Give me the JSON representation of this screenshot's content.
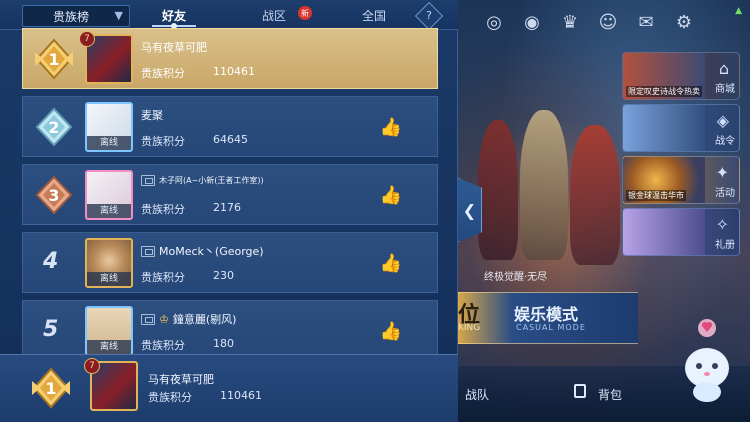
{
  "header": {
    "rank_type": "贵族榜",
    "tabs": [
      {
        "label": "好友",
        "active": true
      },
      {
        "label": "战区",
        "active": false,
        "badge": "新"
      },
      {
        "label": "全国",
        "active": false
      }
    ],
    "help_symbol": "?"
  },
  "leaderboard": {
    "score_label": "贵族积分",
    "offline_label": "离线",
    "rows": [
      {
        "rank": "1",
        "name": "马有夜草可肥",
        "score": "110461",
        "level": "7",
        "is_me": true
      },
      {
        "rank": "2",
        "name": "麦聚",
        "score": "64645"
      },
      {
        "rank": "3",
        "name": "木子阿(A~小新(王者工作室))",
        "score": "2176"
      },
      {
        "rank": "4",
        "name": "MoMeck丶(George)",
        "score": "230"
      },
      {
        "rank": "5",
        "name": "鐘意麗(剔风)",
        "score": "180"
      }
    ]
  },
  "self_bar": {
    "rank": "1",
    "level": "7",
    "name": "马有夜草可肥",
    "score_label": "贵族积分",
    "score": "110461"
  },
  "right_panel": {
    "side_tiles": [
      {
        "label": "商城",
        "caption": "限定叹史诗战令热卖"
      },
      {
        "label": "战令",
        "caption": ""
      },
      {
        "label": "活动",
        "caption": "银金球温击华市"
      },
      {
        "label": "礼册",
        "caption": ""
      }
    ],
    "awaken_text": "终极觉醒·无尽",
    "mode_left": "位",
    "mode_left_sub": "KING",
    "mode_title": "娱乐模式",
    "mode_subtitle": "CASUAL MODE",
    "bottom_team": "战队",
    "bottom_bag": "背包"
  },
  "colors": {
    "accent_blue": "#5fa8ff",
    "gold_row": "#d9c08a",
    "panel_bg": "#1b3a67"
  }
}
